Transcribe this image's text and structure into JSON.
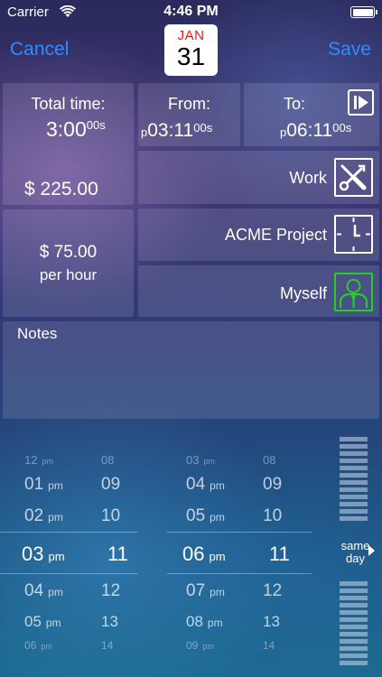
{
  "status_bar": {
    "carrier": "Carrier",
    "time": "4:46 PM"
  },
  "nav": {
    "cancel_label": "Cancel",
    "save_label": "Save",
    "date_month": "JAN",
    "date_day": "31"
  },
  "total": {
    "label": "Total time:",
    "time_main": "3:00",
    "time_sec": "00s",
    "amount": "$ 225.00"
  },
  "from": {
    "label": "From:",
    "prefix": "p",
    "time_main": "03:11",
    "time_sec": "00s"
  },
  "to": {
    "label": "To:",
    "prefix": "p",
    "time_main": "06:11",
    "time_sec": "00s"
  },
  "rate": {
    "amount": "$ 75.00",
    "unit": "per hour"
  },
  "category": {
    "label": "Work",
    "icon": "tools-icon"
  },
  "project": {
    "label": "ACME Project",
    "icon": "clock-icon"
  },
  "client": {
    "label": "Myself",
    "icon": "person-icon",
    "icon_color": "#1fd41f"
  },
  "notes": {
    "label": "Notes"
  },
  "picker": {
    "left": {
      "hours": [
        "12",
        "01",
        "02",
        "03",
        "04",
        "05",
        "06"
      ],
      "ampm": "pm",
      "minutes": [
        "08",
        "09",
        "10",
        "11",
        "12",
        "13",
        "14"
      ]
    },
    "right": {
      "hours": [
        "03",
        "04",
        "05",
        "06",
        "07",
        "08",
        "09"
      ],
      "ampm": "pm",
      "minutes": [
        "08",
        "09",
        "10",
        "11",
        "12",
        "13",
        "14"
      ]
    },
    "same_day_line1": "same",
    "same_day_line2": "day"
  },
  "colors": {
    "accent": "#2f8bff",
    "calendar_month": "#e0201a"
  }
}
